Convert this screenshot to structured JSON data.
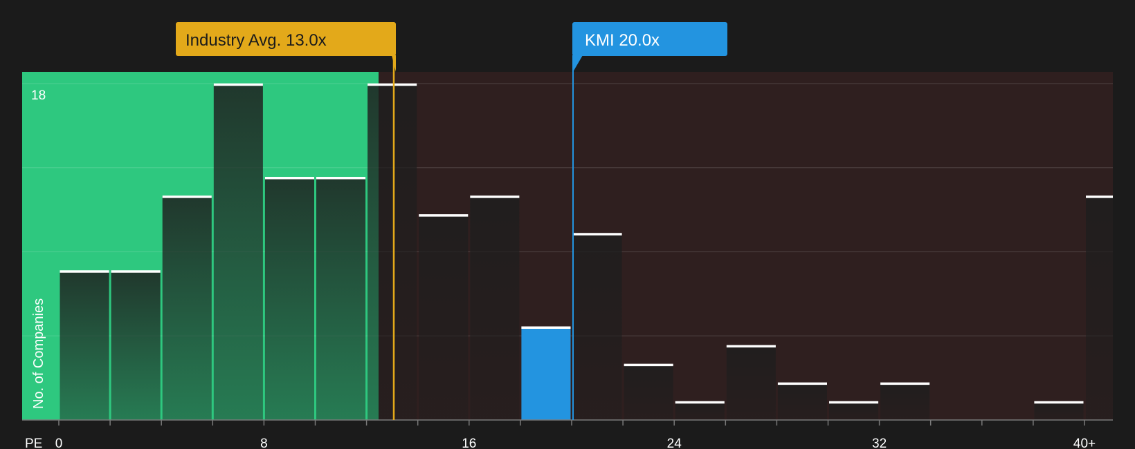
{
  "chart_data": {
    "type": "bar",
    "xlabel": "PE",
    "ylabel": "No. of Companies",
    "x_ticks": [
      "0",
      "8",
      "16",
      "24",
      "32",
      "40+"
    ],
    "y_ticks": [
      "18"
    ],
    "ylim": [
      0,
      18
    ],
    "bin_width": 2,
    "bins": [
      {
        "start": 0,
        "value": 8
      },
      {
        "start": 2,
        "value": 8
      },
      {
        "start": 4,
        "value": 12
      },
      {
        "start": 6,
        "value": 18
      },
      {
        "start": 8,
        "value": 13
      },
      {
        "start": 10,
        "value": 13
      },
      {
        "start": 12,
        "value": 18
      },
      {
        "start": 14,
        "value": 11
      },
      {
        "start": 16,
        "value": 12
      },
      {
        "start": 18,
        "value": 5,
        "highlight": true
      },
      {
        "start": 20,
        "value": 10
      },
      {
        "start": 22,
        "value": 3
      },
      {
        "start": 24,
        "value": 1
      },
      {
        "start": 26,
        "value": 4
      },
      {
        "start": 28,
        "value": 2
      },
      {
        "start": 30,
        "value": 1
      },
      {
        "start": 32,
        "value": 2
      },
      {
        "start": 34,
        "value": 0
      },
      {
        "start": 36,
        "value": 0
      },
      {
        "start": 38,
        "value": 1
      },
      {
        "start": 40,
        "value": 12
      }
    ],
    "industry_avg": {
      "value": 13.0,
      "label": "Industry Avg. 13.0x"
    },
    "company": {
      "value": 20.0,
      "label": "KMI 20.0x"
    },
    "colors": {
      "below_avg_zone": "#2ec87f",
      "above_avg_zone": "#2f1f1f",
      "bar_dark": "#222222",
      "bar_highlight": "#2394e0",
      "industry_line": "#e3a91a",
      "company_line": "#2394e0"
    }
  }
}
